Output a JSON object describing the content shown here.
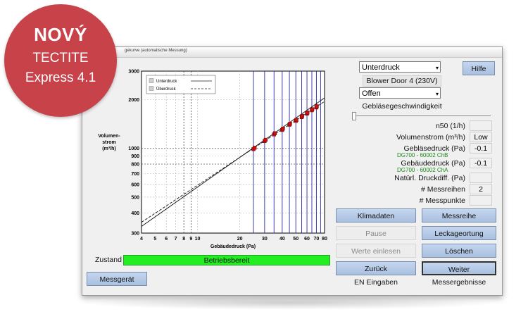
{
  "badge": {
    "line1": "NOVÝ",
    "line2": "TECTITE",
    "line3": "Express 4.1"
  },
  "window": {
    "title": "gekurve (automatische Messung)"
  },
  "controls": {
    "pressure_mode": "Unterdruck",
    "device": "Blower Door 4 (230V)",
    "fan_state": "Offen",
    "fan_speed_label": "Gebläsegeschwindigkeit",
    "help_label": "Hilfe"
  },
  "readouts": {
    "n50_label": "n50 (1/h)",
    "n50_value": "",
    "flow_label": "Volumenstrom (m³/h)",
    "flow_value": "Low",
    "fan_pressure_label": "Gebläsedruck (Pa)",
    "fan_pressure_value": "-0.1",
    "fan_channel": "DG700 - 60002 ChB",
    "building_pressure_label": "Gebäudedruck (Pa)",
    "building_pressure_value": "-0.1",
    "building_channel": "DG700 - 60002 ChA",
    "natural_pressure_label": "Natürl. Druckdiff. (Pa)",
    "natural_pressure_value": "",
    "series_label": "# Messreihen",
    "series_value": "2",
    "points_label": "# Messpunkte",
    "points_value": ""
  },
  "buttons": {
    "klimadaten": "Klimadaten",
    "messreihe": "Messreihe",
    "pause": "Pause",
    "leckageortung": "Leckageortung",
    "werte_einlesen": "Werte einlesen",
    "loeschen": "Löschen",
    "zurueck": "Zurück",
    "weiter": "Weiter",
    "messgeraet": "Messgerät"
  },
  "footer": {
    "en_eingaben": "EN Eingaben",
    "messergebnisse": "Messergebnisse"
  },
  "status": {
    "label": "Zustand",
    "value": "Betriebsbereit"
  },
  "chart_data": {
    "type": "scatter",
    "xlabel": "Gebäudedruck (Pa)",
    "ylabel": [
      "Volumen-",
      "strom",
      "(m³/h)"
    ],
    "xscale": "log",
    "yscale": "log",
    "xlim": [
      4,
      80
    ],
    "ylim": [
      300,
      3000
    ],
    "xticks": [
      4,
      5,
      6,
      7,
      8,
      9,
      10,
      20,
      30,
      40,
      50,
      60,
      70,
      80
    ],
    "xticklabels": [
      "4",
      "5",
      "6",
      "7",
      "8",
      "9",
      "10",
      "20",
      "30",
      "40",
      "50",
      "60",
      "70",
      "80"
    ],
    "yticks": [
      300,
      400,
      500,
      600,
      700,
      800,
      900,
      1000,
      2000,
      3000
    ],
    "yticklabels": [
      "300",
      "400",
      "500",
      "600",
      "700",
      "800",
      "900",
      "1000",
      "2000",
      "3000"
    ],
    "legend": [
      {
        "name": "Unterdruck",
        "style": "solid"
      },
      {
        "name": "Überdruck",
        "style": "dashed"
      }
    ],
    "legend_position": "top-left",
    "vertical_lines": [
      25,
      30,
      35,
      40,
      45,
      50,
      55,
      60,
      65,
      70,
      75
    ],
    "fit_lines": [
      {
        "name": "Unterdruck",
        "style": "solid",
        "points": [
          [
            4,
            330
          ],
          [
            80,
            2050
          ]
        ]
      },
      {
        "name": "Überdruck",
        "style": "dashed",
        "points": [
          [
            4,
            350
          ],
          [
            80,
            1950
          ]
        ]
      }
    ],
    "points": [
      {
        "x": 25,
        "y": 990
      },
      {
        "x": 25.5,
        "y": 1010
      },
      {
        "x": 30,
        "y": 1110
      },
      {
        "x": 30.5,
        "y": 1130
      },
      {
        "x": 35,
        "y": 1220
      },
      {
        "x": 35.5,
        "y": 1240
      },
      {
        "x": 40,
        "y": 1300
      },
      {
        "x": 40.5,
        "y": 1325
      },
      {
        "x": 45,
        "y": 1400
      },
      {
        "x": 45.5,
        "y": 1420
      },
      {
        "x": 50,
        "y": 1480
      },
      {
        "x": 50.5,
        "y": 1500
      },
      {
        "x": 55,
        "y": 1560
      },
      {
        "x": 55.5,
        "y": 1585
      },
      {
        "x": 60,
        "y": 1640
      },
      {
        "x": 60.5,
        "y": 1665
      },
      {
        "x": 65,
        "y": 1720
      },
      {
        "x": 65.5,
        "y": 1745
      },
      {
        "x": 70,
        "y": 1790
      },
      {
        "x": 70.5,
        "y": 1820
      }
    ],
    "series_color": "#cc1111",
    "vline_color": "#2a2aa8"
  }
}
